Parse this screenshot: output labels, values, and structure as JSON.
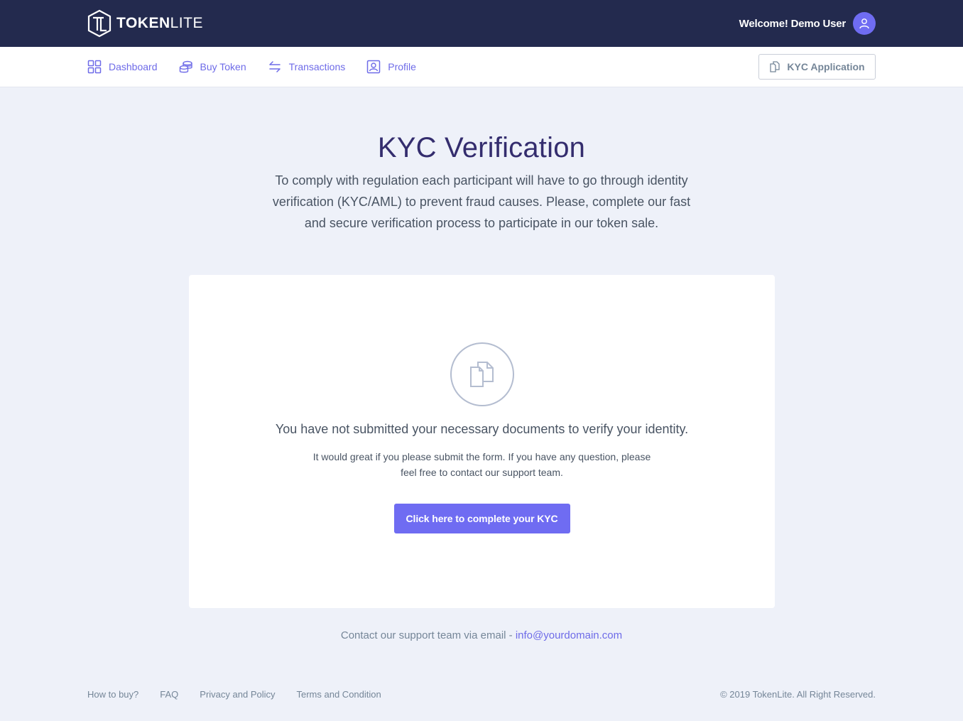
{
  "brand": {
    "name_bold": "TOKEN",
    "name_light": "LITE"
  },
  "header": {
    "welcome": "Welcome! Demo User"
  },
  "nav": {
    "items": [
      {
        "label": "Dashboard",
        "icon": "dashboard-icon"
      },
      {
        "label": "Buy Token",
        "icon": "coins-icon"
      },
      {
        "label": "Transactions",
        "icon": "transfer-arrows-icon"
      },
      {
        "label": "Profile",
        "icon": "profile-icon"
      }
    ],
    "kyc_button": "KYC Application"
  },
  "page": {
    "title": "KYC Verification",
    "intro": "To comply with regulation each participant will have to go through identity verification (KYC/AML) to prevent fraud causes. Please, complete our fast and secure verification process to participate in our token sale."
  },
  "card": {
    "icon": "documents-icon",
    "title": "You have not submitted your necessary documents to verify your identity.",
    "description": "It would great if you please submit the form. If you have any question, please feel free to contact our support team.",
    "cta": "Click here to complete your KYC"
  },
  "support": {
    "text": "Contact our support team via email - ",
    "email": "info@yourdomain.com"
  },
  "footer": {
    "links": [
      "How to buy?",
      "FAQ",
      "Privacy and Policy",
      "Terms and Condition"
    ],
    "copyright": "© 2019 TokenLite. All Right Reserved."
  },
  "colors": {
    "topbar": "#232a4e",
    "accent": "#6f6cf2",
    "background": "#eef1f9",
    "title": "#342d6e"
  }
}
